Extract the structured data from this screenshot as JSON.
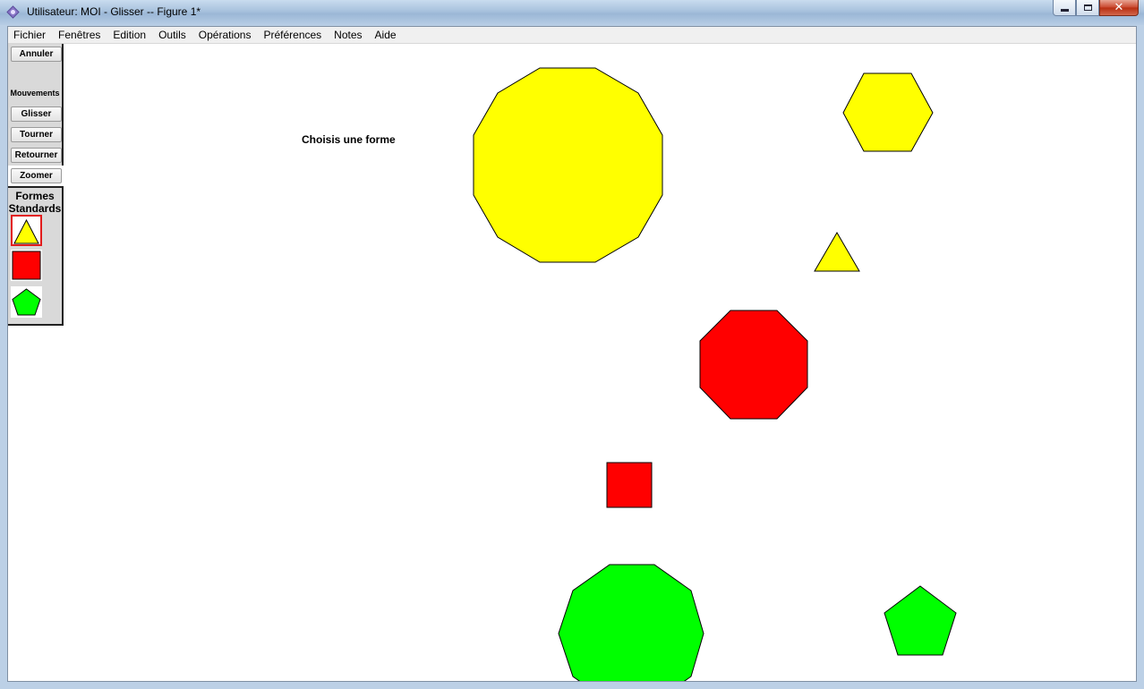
{
  "window": {
    "title": "Utilisateur: MOI - Glisser -- Figure 1*",
    "buttons": {
      "minimize": "minimize-icon",
      "maximize": "maximize-icon",
      "close": "close-icon"
    }
  },
  "menu": {
    "items": [
      "Fichier",
      "Fenêtres",
      "Edition",
      "Outils",
      "Opérations",
      "Préférences",
      "Notes",
      "Aide"
    ]
  },
  "toolbar": {
    "undo": "Annuler",
    "moves_label": "Mouvements",
    "slide": "Glisser",
    "turn": "Tourner",
    "flip": "Retourner",
    "zoom": "Zoomer"
  },
  "shapes_panel": {
    "title_line1": "Formes",
    "title_line2": "Standards",
    "items": [
      {
        "name": "triangle",
        "color": "#ffff00",
        "selected": true
      },
      {
        "name": "square",
        "color": "#ff0000",
        "selected": false
      },
      {
        "name": "pentagon",
        "color": "#00ff00",
        "selected": false
      }
    ]
  },
  "canvas": {
    "prompt": "Choisis une forme",
    "shapes": [
      {
        "type": "dodecagon",
        "color": "#ffff00"
      },
      {
        "type": "hexagon",
        "color": "#ffff00"
      },
      {
        "type": "triangle",
        "color": "#ffff00"
      },
      {
        "type": "octagon",
        "color": "#ff0000"
      },
      {
        "type": "square",
        "color": "#ff0000"
      },
      {
        "type": "decagon",
        "color": "#00ff00"
      },
      {
        "type": "pentagon",
        "color": "#00ff00"
      }
    ]
  },
  "colors": {
    "yellow": "#ffff00",
    "red": "#ff0000",
    "green": "#00ff00",
    "selection": "#e21c1c"
  }
}
